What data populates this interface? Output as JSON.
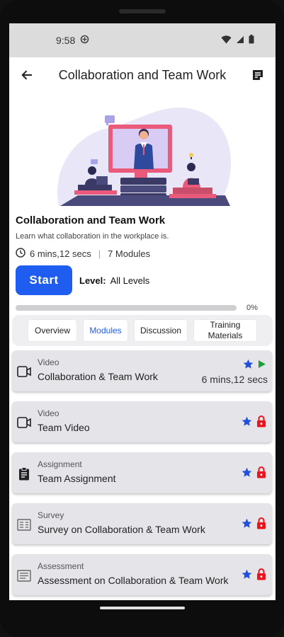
{
  "status": {
    "time": "9:58"
  },
  "appbar": {
    "title": "Collaboration and Team Work"
  },
  "course": {
    "title": "Collaboration and Team Work",
    "description": "Learn what collaboration in the workplace is.",
    "duration": "6 mins,12 secs",
    "modules_count": "7 Modules",
    "start_label": "Start",
    "level_label": "Level:",
    "level_value": "All Levels",
    "progress_text": "0%",
    "progress": 0
  },
  "tabs": [
    {
      "label": "Overview"
    },
    {
      "label": "Modules"
    },
    {
      "label": "Discussion"
    },
    {
      "label": "Training Materials"
    }
  ],
  "modules": [
    {
      "type": "Video",
      "name": "Collaboration & Team Work",
      "duration": "6 mins,12 secs",
      "icon": "video-icon",
      "status_icon": "play-icon"
    },
    {
      "type": "Video",
      "name": "Team Video",
      "icon": "video-icon",
      "status_icon": "lock-icon"
    },
    {
      "type": "Assignment",
      "name": "Team Assignment",
      "icon": "clipboard-icon",
      "status_icon": "lock-icon"
    },
    {
      "type": "Survey",
      "name": "Survey on Collaboration & Team Work",
      "icon": "survey-icon",
      "status_icon": "lock-icon"
    },
    {
      "type": "Assessment",
      "name": "Assessment on Collaboration & Team Work",
      "icon": "assessment-icon",
      "status_icon": "lock-icon"
    }
  ],
  "colors": {
    "accent": "#1f5cf0",
    "lock": "#e8141e",
    "play": "#1aa13a",
    "star": "#1f4fe0"
  }
}
